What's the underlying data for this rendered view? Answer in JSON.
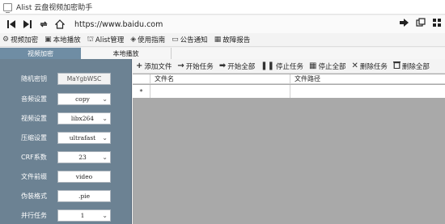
{
  "window": {
    "title": "Alist 云盘视频加密助手"
  },
  "navbar": {
    "url": "https://www.baidu.com"
  },
  "menu": [
    {
      "label": "视频加密",
      "icon": "gear-icon",
      "glyph": "⚙"
    },
    {
      "label": "本地播放",
      "icon": "play-window-icon",
      "glyph": "▣"
    },
    {
      "label": "Alist管理",
      "icon": "bank-icon",
      "glyph": "⛫"
    },
    {
      "label": "使用指南",
      "icon": "box-icon",
      "glyph": "◈"
    },
    {
      "label": "公告通知",
      "icon": "chat-icon",
      "glyph": "▭"
    },
    {
      "label": "故障报告",
      "icon": "report-icon",
      "glyph": "▦"
    }
  ],
  "tabs": {
    "active": "视频加密",
    "inactive": "本地播放"
  },
  "settings": [
    {
      "label": "随机密钥",
      "value": "MaYgbWSC",
      "kind": "button"
    },
    {
      "label": "音频设置",
      "value": "copy",
      "kind": "select"
    },
    {
      "label": "视频设置",
      "value": "libx264",
      "kind": "select"
    },
    {
      "label": "压缩设置",
      "value": "ultrafast",
      "kind": "select"
    },
    {
      "label": "CRF系数",
      "value": "23",
      "kind": "select"
    },
    {
      "label": "文件前缀",
      "value": "video",
      "kind": "input"
    },
    {
      "label": "伪装格式",
      "value": ".pie",
      "kind": "input"
    },
    {
      "label": "并行任务",
      "value": "1",
      "kind": "select"
    }
  ],
  "toolbar": [
    {
      "label": "添加文件",
      "icon": "plus-icon",
      "glyph": "+"
    },
    {
      "label": "开始任务",
      "icon": "arrow-right-icon",
      "glyph": "→"
    },
    {
      "label": "开始全部",
      "icon": "play-all-icon",
      "glyph": "➡"
    },
    {
      "label": "停止任务",
      "icon": "pause-icon",
      "glyph": "❚❚"
    },
    {
      "label": "停止全部",
      "icon": "grid-stop-icon",
      "glyph": "▦"
    },
    {
      "label": "删除任务",
      "icon": "close-icon",
      "glyph": "✕"
    },
    {
      "label": "删除全部",
      "icon": "trash-icon",
      "glyph": "🗑"
    }
  ],
  "grid": {
    "columns": [
      "文件名",
      "文件路径"
    ],
    "new_row_marker": "*"
  }
}
